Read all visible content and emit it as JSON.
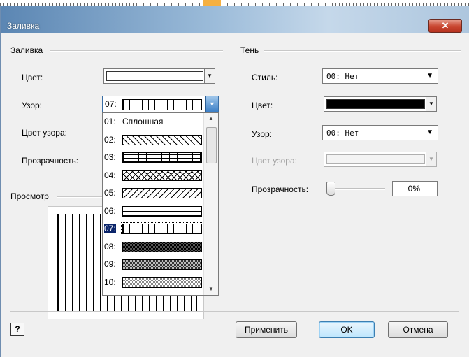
{
  "window": {
    "title": "Заливка",
    "close_icon": "close-icon"
  },
  "fill": {
    "group_label": "Заливка",
    "color_label": "Цвет:",
    "color_value": "#ffffff",
    "pattern_label": "Узор:",
    "pattern_value_num": "07:",
    "pattern_color_label": "Цвет узора:",
    "transparency_label": "Прозрачность:"
  },
  "pattern_list": [
    {
      "num": "01:",
      "text": "Сплошная",
      "pattern": "solid"
    },
    {
      "num": "02:",
      "text": "",
      "pattern": "diag-back"
    },
    {
      "num": "03:",
      "text": "",
      "pattern": "grid"
    },
    {
      "num": "04:",
      "text": "",
      "pattern": "crosshatch"
    },
    {
      "num": "05:",
      "text": "",
      "pattern": "diag-fwd"
    },
    {
      "num": "06:",
      "text": "",
      "pattern": "horizontal"
    },
    {
      "num": "07:",
      "text": "",
      "pattern": "vertical",
      "selected": true
    },
    {
      "num": "08:",
      "text": "",
      "pattern": "dense-dots"
    },
    {
      "num": "09:",
      "text": "",
      "pattern": "medium-dots"
    },
    {
      "num": "10:",
      "text": "",
      "pattern": "light-dots"
    }
  ],
  "preview": {
    "label": "Просмотр"
  },
  "shadow": {
    "group_label": "Тень",
    "style_label": "Стиль:",
    "style_value": "00: Нет",
    "color_label": "Цвет:",
    "color_value": "#000000",
    "pattern_label": "Узор:",
    "pattern_value": "00: Нет",
    "pattern_color_label": "Цвет узора:",
    "transparency_label": "Прозрачность:",
    "transparency_value": "0%"
  },
  "buttons": {
    "help": "?",
    "apply": "Применить",
    "ok": "OK",
    "cancel": "Отмена"
  }
}
